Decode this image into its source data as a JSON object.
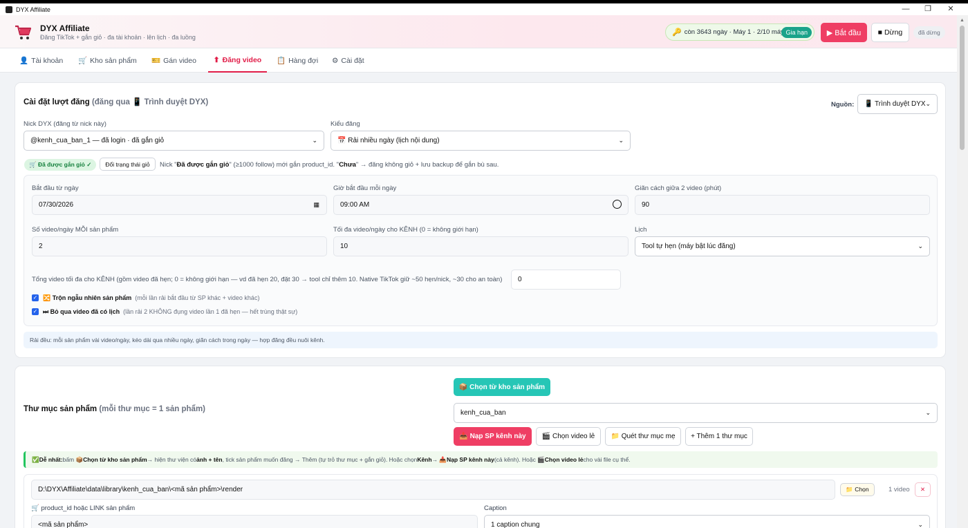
{
  "window": {
    "title": "DYX Affiliate",
    "minimize": "—",
    "maximize": "❐",
    "close": "✕"
  },
  "header": {
    "title": "DYX Affiliate",
    "subtitle": "Đăng TikTok + gắn giỏ · đa tài khoản · lên lịch · đa luồng",
    "license_text": "còn 3643 ngày · Máy 1 · 2/10 máy",
    "renew_label": "Gia hạn",
    "start_label": "▶ Bắt đầu",
    "stop_label": "■ Dừng",
    "state_label": "đã dừng"
  },
  "tabs": [
    {
      "icon": "👤",
      "label": "Tài khoản"
    },
    {
      "icon": "🛒",
      "label": "Kho sản phẩm"
    },
    {
      "icon": "🎫",
      "label": "Gán video"
    },
    {
      "icon": "⬆",
      "label": "Đăng video"
    },
    {
      "icon": "📋",
      "label": "Hàng đợi"
    },
    {
      "icon": "⚙",
      "label": "Cài đặt"
    }
  ],
  "settings": {
    "heading": "Cài đặt lượt đăng",
    "heading_note": "(đăng qua 📱 Trình duyệt DYX)",
    "source_label": "Nguồn:",
    "source_value": "📱 Trình duyệt DYX",
    "nick_label": "Nick DYX (đăng từ nick này)",
    "nick_value": "@kenh_cua_ban_1 — đã login · đã gắn giỏ",
    "mode_label": "Kiểu đăng",
    "mode_value": "📅 Rải nhiều ngày (lịch nội dung)",
    "cart_tag": "🛒 Đã được gắn giỏ ✓",
    "cart_btn": "Đổi trạng thái giỏ",
    "cart_note_1": "Nick \"",
    "cart_note_b1": "Đã được gắn giỏ",
    "cart_note_2": "\" (≥1000 follow) mới gắn product_id. \"",
    "cart_note_b2": "Chưa",
    "cart_note_3": "\" → đăng không giỏ + lưu backup để gắn bù sau.",
    "start_date_label": "Bắt đầu từ ngày",
    "start_date_value": "07/30/2026",
    "start_time_label": "Giờ bắt đầu mỗi ngày",
    "start_time_value": "09:00 AM",
    "gap_label": "Giãn cách giữa 2 video (phút)",
    "gap_value": "90",
    "per_product_label": "Số video/ngày MỖI sản phẩm",
    "per_product_value": "2",
    "per_channel_label": "Tối đa video/ngày cho KÊNH (0 = không giới hạn)",
    "per_channel_value": "10",
    "schedule_label": "Lịch",
    "schedule_value": "Tool tự hẹn (máy bật lúc đăng)",
    "total_label": "Tổng video tối đa cho KÊNH (gồm video đã hẹn; 0 = không giới hạn — vd đã hẹn 20, đặt 30 → tool chỉ thêm 10. Native TikTok giữ ~50 hẹn/nick, ~30 cho an toàn)",
    "total_value": "0",
    "shuffle_label": "🔀 Trộn ngẫu nhiên sản phẩm",
    "shuffle_note": "(mỗi lần rải bắt đầu từ SP khác + video khác)",
    "skip_label": "⏭ Bỏ qua video đã có lịch",
    "skip_note": "(lần rải 2 KHÔNG đụng video lần 1 đã hẹn — hết trùng thật sự)",
    "hint": "Rải đều: mỗi sản phẩm vài video/ngày, kéo dài qua nhiều ngày, giãn cách trong ngày — hợp đăng đều nuôi kênh."
  },
  "folders": {
    "heading": "Thư mục sản phẩm",
    "heading_note": "(mỗi thư mục = 1 sản phẩm)",
    "pick_btn": "📦 Chọn từ kho sản phẩm",
    "channel_value": "kenh_cua_ban",
    "load_btn": "📥 Nạp SP kênh này",
    "single_btn": "🎬 Chọn video lẻ",
    "scan_btn": "📁 Quét thư mục mẹ",
    "add_btn": "+ Thêm 1 thư mục",
    "hint_parts": {
      "p1": "✅ ",
      "b1": "Dễ nhất:",
      "p2": " bấm 📦 ",
      "b2": "Chọn từ kho sản phẩm",
      "p3": " → hiện thư viện có ",
      "b3": "ảnh + tên",
      "p4": ", tick sản phẩm muốn đăng → Thêm (tự trỏ thư mục + gắn giỏ). Hoặc chọn ",
      "b4": "Kênh",
      "p5": " → 📥 ",
      "b5": "Nạp SP kênh này",
      "p6": " (cả kênh). Hoặc 🎬 ",
      "b6": "Chọn video lẻ",
      "p7": " cho vài file cụ thể."
    },
    "row": {
      "path": "D:\\DYX\\Affiliate\\data\\library\\kenh_cua_ban\\<mã sản phẩm>\\render",
      "choose_btn": "📁 Chọn",
      "count": "1 video",
      "remove": "✕",
      "pid_label": "🛒 product_id hoặc LINK sản phẩm",
      "pid_value": "<mã sản phẩm>",
      "caption_label": "Caption",
      "caption_value": "1 caption chung"
    }
  }
}
